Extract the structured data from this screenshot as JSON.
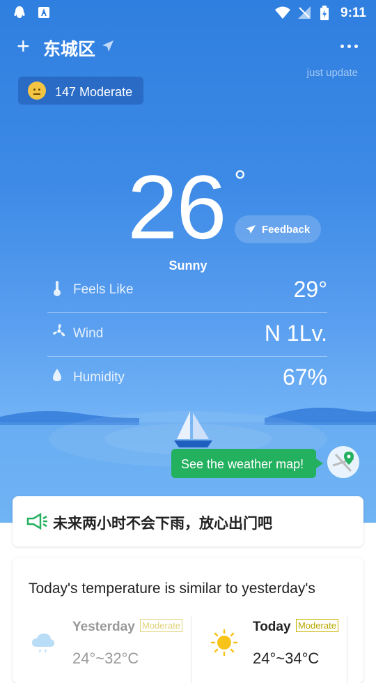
{
  "status_bar": {
    "time": "9:11"
  },
  "header": {
    "city": "东城区"
  },
  "update_text": "just update",
  "aqi": {
    "label": "147 Moderate"
  },
  "current": {
    "temperature": "26",
    "degree_symbol": "°",
    "condition": "Sunny"
  },
  "feedback": {
    "label": "Feedback"
  },
  "details": [
    {
      "label": "Feels Like",
      "value": "29°",
      "icon": "thermometer-icon"
    },
    {
      "label": "Wind",
      "value": "N 1Lv.",
      "icon": "fan-icon"
    },
    {
      "label": "Humidity",
      "value": "67%",
      "icon": "water-drop-icon"
    }
  ],
  "weather_map": {
    "label": "See the weather map!"
  },
  "notice": {
    "text": "未来两小时不会下雨，放心出门吧"
  },
  "comparison": {
    "title": "Today's temperature is similar to yesterday's",
    "yesterday": {
      "name": "Yesterday",
      "badge": "Moderate",
      "range": "24°~32°C",
      "icon": "cloud-icon"
    },
    "today": {
      "name": "Today",
      "badge": "Moderate",
      "range": "24°~34°C",
      "icon": "sun-icon"
    }
  },
  "colors": {
    "sky_top": "#2f7fe0",
    "accent_green": "#23b05f",
    "badge_yellow": "#c8b400"
  }
}
